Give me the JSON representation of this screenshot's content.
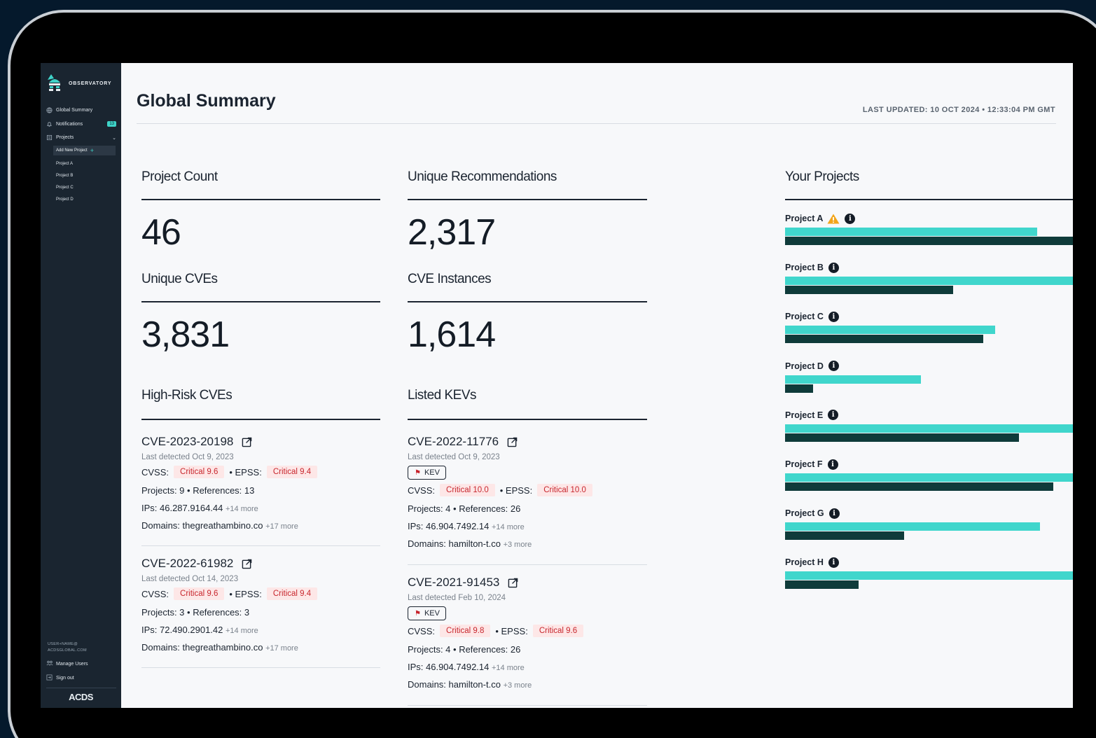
{
  "sidebar": {
    "brand": "OBSERVATORY",
    "nav": [
      {
        "label": "Global Summary",
        "icon": "globe-icon"
      },
      {
        "label": "Notifications",
        "icon": "bell-icon",
        "badge": "13"
      },
      {
        "label": "Projects",
        "icon": "folder-icon"
      }
    ],
    "add_project": "Add New Project",
    "projects": [
      "Project A",
      "Project B",
      "Project C",
      "Project D"
    ],
    "user_email_line1": "USER+NAME@",
    "user_email_line2": "ACDSGLOBAL.COM",
    "manage_users": "Manage Users",
    "sign_out": "Sign out",
    "footer_logo": "ACDS"
  },
  "header": {
    "title": "Global Summary",
    "last_updated": "LAST UPDATED: 10 OCT 2024 • 12:33:04 PM GMT"
  },
  "stats": {
    "project_count": {
      "label": "Project Count",
      "value": "46"
    },
    "unique_recommendations": {
      "label": "Unique Recommendations",
      "value": "2,317"
    },
    "unique_cves": {
      "label": "Unique CVEs",
      "value": "3,831"
    },
    "cve_instances": {
      "label": "CVE Instances",
      "value": "1,614"
    }
  },
  "high_risk": {
    "label": "High-Risk CVEs",
    "items": [
      {
        "id": "CVE-2023-20198",
        "detected": "Last detected Oct 9, 2023",
        "cvss_label": "CVSS:",
        "cvss": "Critical 9.6",
        "epss_label": "• EPSS:",
        "epss": "Critical 9.4",
        "projects_refs": "Projects: 9 • References: 13",
        "ips": "IPs: 46.287.9164.44",
        "ips_more": "+14 more",
        "domains": "Domains: thegreathambino.co",
        "domains_more": "+17 more"
      },
      {
        "id": "CVE-2022-61982",
        "detected": "Last detected Oct 14, 2023",
        "cvss_label": "CVSS:",
        "cvss": "Critical 9.6",
        "epss_label": "• EPSS:",
        "epss": "Critical 9.4",
        "projects_refs": "Projects: 3 • References: 3",
        "ips": "IPs: 72.490.2901.42",
        "ips_more": "+14 more",
        "domains": "Domains: thegreathambino.co",
        "domains_more": "+17 more"
      }
    ]
  },
  "kevs": {
    "label": "Listed KEVs",
    "items": [
      {
        "id": "CVE-2022-11776",
        "detected": "Last detected Oct 9, 2023",
        "kev": "KEV",
        "cvss_label": "CVSS:",
        "cvss": "Critical 10.0",
        "epss_label": "• EPSS:",
        "epss": "Critical 10.0",
        "projects_refs": "Projects: 4 • References: 26",
        "ips": "IPs: 46.904.7492.14",
        "ips_more": "+14 more",
        "domains": "Domains: hamilton-t.co",
        "domains_more": "+3 more"
      },
      {
        "id": "CVE-2021-91453",
        "detected": "Last detected Feb 10, 2024",
        "kev": "KEV",
        "cvss_label": "CVSS:",
        "cvss": "Critical 9.8",
        "epss_label": "• EPSS:",
        "epss": "Critical 9.6",
        "projects_refs": "Projects: 4 • References: 26",
        "ips": "IPs: 46.904.7492.14",
        "ips_more": "+14 more",
        "domains": "Domains: hamilton-t.co",
        "domains_more": "+3 more"
      }
    ]
  },
  "your_projects": {
    "label": "Your Projects",
    "colors": {
      "teal": "#40d6cc",
      "dark": "#0f3b3a"
    },
    "items": [
      {
        "name": "Project A",
        "warning": true,
        "teal": 0.72,
        "dark": 0.835
      },
      {
        "name": "Project B",
        "warning": false,
        "teal": 0.95,
        "dark": 0.48
      },
      {
        "name": "Project C",
        "warning": false,
        "teal": 0.6,
        "dark": 0.565
      },
      {
        "name": "Project D",
        "warning": false,
        "teal": 0.387,
        "dark": 0.08
      },
      {
        "name": "Project E",
        "warning": false,
        "teal": 0.996,
        "dark": 0.668
      },
      {
        "name": "Project F",
        "warning": false,
        "teal": 0.907,
        "dark": 0.765
      },
      {
        "name": "Project G",
        "warning": false,
        "teal": 0.728,
        "dark": 0.34
      },
      {
        "name": "Project H",
        "warning": false,
        "teal": 0.853,
        "dark": 0.21
      }
    ]
  }
}
